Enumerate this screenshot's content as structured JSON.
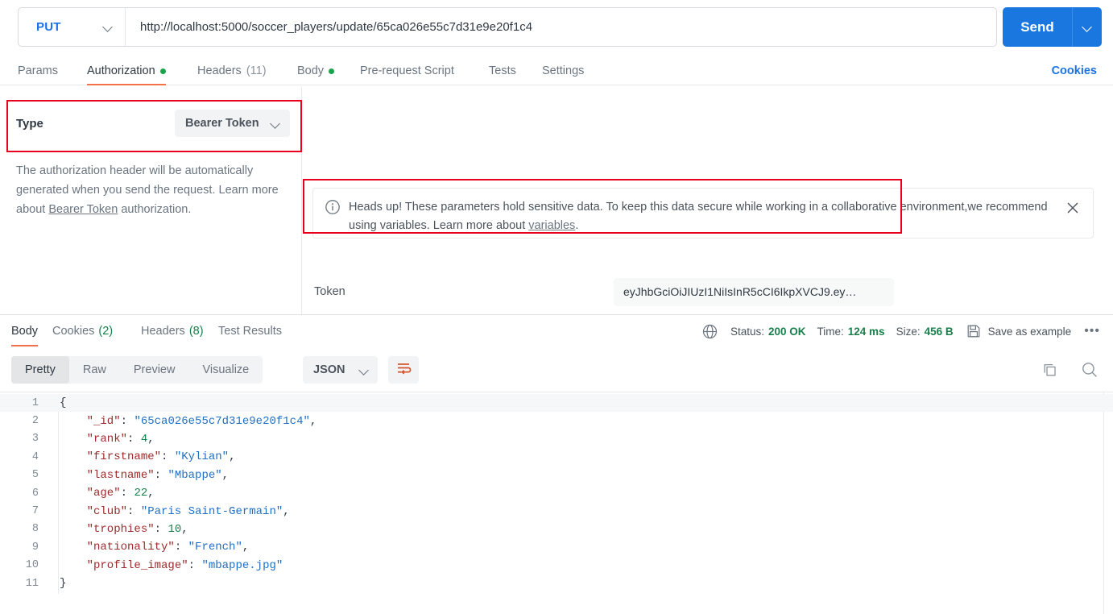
{
  "request": {
    "method": "PUT",
    "url": "http://localhost:5000/soccer_players/update/65ca026e55c7d31e9e20f1c4",
    "send_label": "Send",
    "tabs": [
      {
        "label": "Params",
        "active": false,
        "dot": false,
        "count": ""
      },
      {
        "label": "Authorization",
        "active": true,
        "dot": true,
        "count": ""
      },
      {
        "label": "Headers",
        "active": false,
        "dot": false,
        "count": "(11)"
      },
      {
        "label": "Body",
        "active": false,
        "dot": true,
        "count": ""
      },
      {
        "label": "Pre-request Script",
        "active": false,
        "dot": false,
        "count": ""
      },
      {
        "label": "Tests",
        "active": false,
        "dot": false,
        "count": ""
      },
      {
        "label": "Settings",
        "active": false,
        "dot": false,
        "count": ""
      }
    ],
    "cookies_link": "Cookies"
  },
  "auth": {
    "type_label": "Type",
    "type_value": "Bearer Token",
    "help_prefix": "The authorization header will be automatically generated when you send the request. Learn more about ",
    "help_link": "Bearer Token",
    "help_suffix": " authorization.",
    "banner": {
      "text_prefix": "Heads up! These parameters hold sensitive data. To keep this data secure while working in a collaborative environment,we recommend using variables. Learn more about ",
      "link": "variables",
      "text_suffix": "."
    },
    "token_label": "Token",
    "token_value": "eyJhbGciOiJIUzI1NiIsInR5cCI6IkpXVCJ9.ey…"
  },
  "response": {
    "tabs": [
      {
        "label": "Body",
        "count": "",
        "active": true
      },
      {
        "label": "Cookies",
        "count": "(2)",
        "active": false
      },
      {
        "label": "Headers",
        "count": "(8)",
        "active": false
      },
      {
        "label": "Test Results",
        "count": "",
        "active": false
      }
    ],
    "status_label": "Status:",
    "status_value": "200 OK",
    "time_label": "Time:",
    "time_value": "124 ms",
    "size_label": "Size:",
    "size_value": "456 B",
    "save_example_label": "Save as example",
    "view_modes": [
      "Pretty",
      "Raw",
      "Preview",
      "Visualize"
    ],
    "view_mode_active": "Pretty",
    "format": "JSON",
    "body": {
      "lines": [
        {
          "num": "1",
          "tokens": [
            {
              "t": "{",
              "c": "p"
            }
          ]
        },
        {
          "num": "2",
          "tokens": [
            {
              "t": "    \"_id\"",
              "c": "k"
            },
            {
              "t": ": ",
              "c": "p"
            },
            {
              "t": "\"65ca026e55c7d31e9e20f1c4\"",
              "c": "s"
            },
            {
              "t": ",",
              "c": "p"
            }
          ]
        },
        {
          "num": "3",
          "tokens": [
            {
              "t": "    \"rank\"",
              "c": "k"
            },
            {
              "t": ": ",
              "c": "p"
            },
            {
              "t": "4",
              "c": "n"
            },
            {
              "t": ",",
              "c": "p"
            }
          ]
        },
        {
          "num": "4",
          "tokens": [
            {
              "t": "    \"firstname\"",
              "c": "k"
            },
            {
              "t": ": ",
              "c": "p"
            },
            {
              "t": "\"Kylian\"",
              "c": "s"
            },
            {
              "t": ",",
              "c": "p"
            }
          ]
        },
        {
          "num": "5",
          "tokens": [
            {
              "t": "    \"lastname\"",
              "c": "k"
            },
            {
              "t": ": ",
              "c": "p"
            },
            {
              "t": "\"Mbappe\"",
              "c": "s"
            },
            {
              "t": ",",
              "c": "p"
            }
          ]
        },
        {
          "num": "6",
          "tokens": [
            {
              "t": "    \"age\"",
              "c": "k"
            },
            {
              "t": ": ",
              "c": "p"
            },
            {
              "t": "22",
              "c": "n"
            },
            {
              "t": ",",
              "c": "p"
            }
          ]
        },
        {
          "num": "7",
          "tokens": [
            {
              "t": "    \"club\"",
              "c": "k"
            },
            {
              "t": ": ",
              "c": "p"
            },
            {
              "t": "\"Paris Saint-Germain\"",
              "c": "s"
            },
            {
              "t": ",",
              "c": "p"
            }
          ]
        },
        {
          "num": "8",
          "tokens": [
            {
              "t": "    \"trophies\"",
              "c": "k"
            },
            {
              "t": ": ",
              "c": "p"
            },
            {
              "t": "10",
              "c": "n"
            },
            {
              "t": ",",
              "c": "p"
            }
          ]
        },
        {
          "num": "9",
          "tokens": [
            {
              "t": "    \"nationality\"",
              "c": "k"
            },
            {
              "t": ": ",
              "c": "p"
            },
            {
              "t": "\"French\"",
              "c": "s"
            },
            {
              "t": ",",
              "c": "p"
            }
          ]
        },
        {
          "num": "10",
          "tokens": [
            {
              "t": "    \"profile_image\"",
              "c": "k"
            },
            {
              "t": ": ",
              "c": "p"
            },
            {
              "t": "\"mbappe.jpg\"",
              "c": "s"
            }
          ]
        },
        {
          "num": "11",
          "tokens": [
            {
              "t": "}",
              "c": "p"
            }
          ]
        }
      ]
    }
  },
  "colors": {
    "accent_orange": "#f2714a",
    "link_blue": "#1b72e8",
    "send_blue": "#1b77e0",
    "green": "#1aa34a",
    "status_green": "#1a7f4b",
    "annotation_red": "#e8001c",
    "json_key": "#9c2b2b",
    "json_string": "#1f6fc4",
    "json_number": "#1a7f4b"
  }
}
